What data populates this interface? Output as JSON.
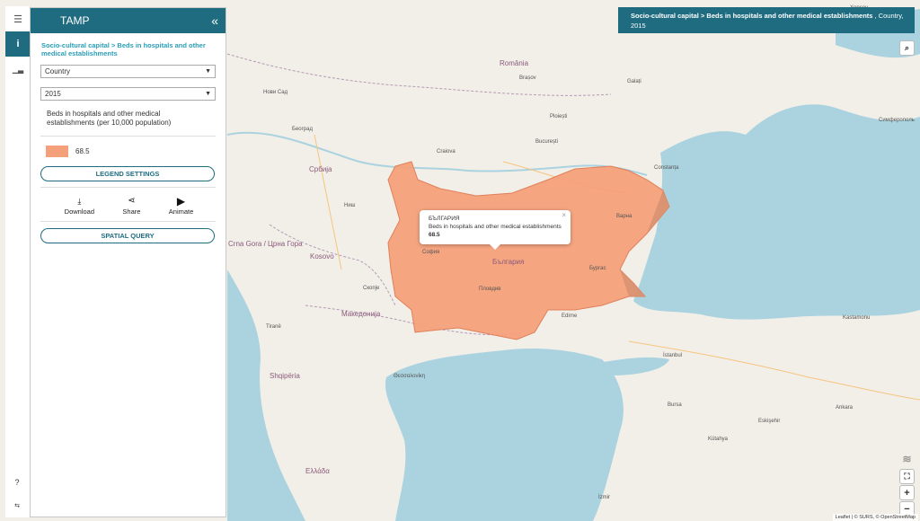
{
  "app": {
    "title": "TAMP"
  },
  "panel": {
    "breadcrumb": "Socio-cultural capital > Beds in hospitals and other medical establishments",
    "unit_select": "Country",
    "year_select": "2015",
    "indicator_desc": "Beds in hospitals and other medical establishments (per 10,000 population)",
    "legend_value": "68.5",
    "legend_color": "#f4a07a",
    "legend_settings_label": "LEGEND SETTINGS",
    "actions": [
      {
        "label": "Download",
        "icon": "download-icon"
      },
      {
        "label": "Share",
        "icon": "share-icon"
      },
      {
        "label": "Animate",
        "icon": "play-icon"
      }
    ],
    "spatial_query_label": "SPATIAL QUERY"
  },
  "info_box": {
    "indicator": "Socio-cultural capital > Beds in hospitals and other medical establishments",
    "rest": " , Country, 2015"
  },
  "popup": {
    "country": "БЪЛГАРИЯ",
    "indicator": "Beds in hospitals and other medical establishments",
    "value": "68.5"
  },
  "map": {
    "highlight_color": "#f4a07a",
    "labels": {
      "romania": "România",
      "bulgaria": "България",
      "srbija": "Србија",
      "makedonija": "Македонија",
      "shqiperia": "Shqipëria",
      "kosovo": "Kosovo",
      "elliada": "Ελλάδα",
      "crna_gora": "Crna Gora / Црна Гора",
      "beograd": "Београд",
      "bucuresti": "București",
      "craiova": "Craiova",
      "constanta": "Constanța",
      "istanbul": "İstanbul",
      "edirne": "Edirne",
      "skopje": "Скопје",
      "tirane": "Tiranë",
      "thessaloniki": "Θεσσαλονίκη",
      "ankara": "Ankara",
      "bursa": "Bursa",
      "izmir": "İzmir",
      "kastamonu": "Kastamonu",
      "kutahya": "Kütahya",
      "eskisehir": "Eskişehir",
      "nis": "Ниш",
      "brasov": "Brașov",
      "galati": "Galați",
      "ploiesti": "Ploiești",
      "novi_sad": "Нови Сад",
      "kherson": "Херсон",
      "simferopol": "Симферополь",
      "sofia": "София",
      "plovdiv": "Пловдив",
      "varna": "Варна",
      "burgas": "Бургас"
    }
  },
  "attribution": "Leaflet | © SURS, © OpenStreetMap"
}
